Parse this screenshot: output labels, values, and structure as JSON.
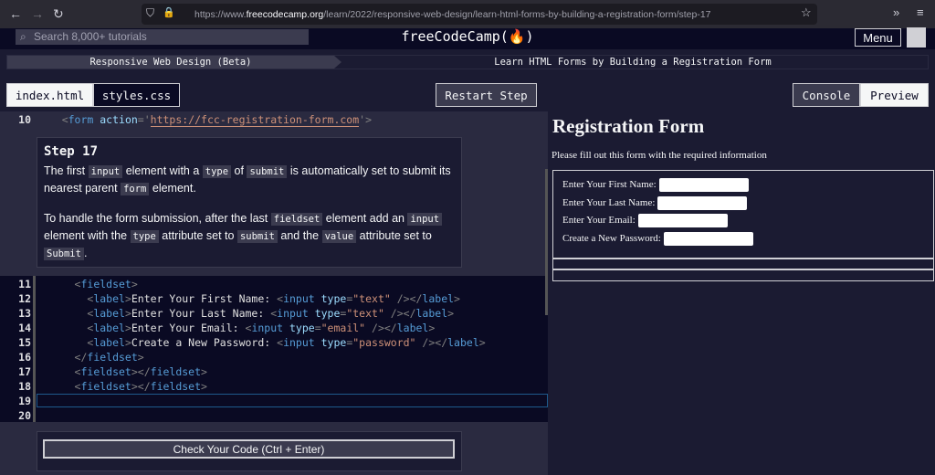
{
  "browser": {
    "url_prefix": "https://www.",
    "url_domain": "freecodecamp.org",
    "url_path": "/learn/2022/responsive-web-design/learn-html-forms-by-building-a-registration-form/step-17"
  },
  "nav": {
    "search_placeholder": "Search 8,000+ tutorials",
    "logo": "freeCodeCamp(🔥)",
    "menu": "Menu"
  },
  "breadcrumb": {
    "superblock": "Responsive Web Design (Beta)",
    "block": "Learn HTML Forms by Building a Registration Form"
  },
  "toolbar": {
    "tabs": [
      "index.html",
      "styles.css"
    ],
    "restart": "Restart Step",
    "console": "Console",
    "preview": "Preview"
  },
  "editor": {
    "line10": {
      "num": "10",
      "tokens": [
        [
          "t",
          "    <"
        ],
        [
          "n",
          "form"
        ],
        [
          "a",
          " action"
        ],
        [
          "t",
          "='"
        ],
        [
          "s",
          "https://fcc-registration-form.com"
        ],
        [
          "t",
          "'>"
        ]
      ]
    },
    "lines": [
      {
        "num": "11",
        "tokens": [
          [
            "t",
            "      <"
          ],
          [
            "n",
            "fieldset"
          ],
          [
            "t",
            ">"
          ]
        ]
      },
      {
        "num": "12",
        "tokens": [
          [
            "t",
            "        <"
          ],
          [
            "n",
            "label"
          ],
          [
            "t",
            ">"
          ],
          [
            "x",
            "Enter Your First Name: "
          ],
          [
            "t",
            "<"
          ],
          [
            "n",
            "input"
          ],
          [
            "a",
            " type"
          ],
          [
            "t",
            "="
          ],
          [
            "s",
            "\"text\""
          ],
          [
            "t",
            " /></"
          ],
          [
            "n",
            "label"
          ],
          [
            "t",
            ">"
          ]
        ]
      },
      {
        "num": "13",
        "tokens": [
          [
            "t",
            "        <"
          ],
          [
            "n",
            "label"
          ],
          [
            "t",
            ">"
          ],
          [
            "x",
            "Enter Your Last Name: "
          ],
          [
            "t",
            "<"
          ],
          [
            "n",
            "input"
          ],
          [
            "a",
            " type"
          ],
          [
            "t",
            "="
          ],
          [
            "s",
            "\"text\""
          ],
          [
            "t",
            " /></"
          ],
          [
            "n",
            "label"
          ],
          [
            "t",
            ">"
          ]
        ]
      },
      {
        "num": "14",
        "tokens": [
          [
            "t",
            "        <"
          ],
          [
            "n",
            "label"
          ],
          [
            "t",
            ">"
          ],
          [
            "x",
            "Enter Your Email: "
          ],
          [
            "t",
            "<"
          ],
          [
            "n",
            "input"
          ],
          [
            "a",
            " type"
          ],
          [
            "t",
            "="
          ],
          [
            "s",
            "\"email\""
          ],
          [
            "t",
            " /></"
          ],
          [
            "n",
            "label"
          ],
          [
            "t",
            ">"
          ]
        ]
      },
      {
        "num": "15",
        "tokens": [
          [
            "t",
            "        <"
          ],
          [
            "n",
            "label"
          ],
          [
            "t",
            ">"
          ],
          [
            "x",
            "Create a New Password: "
          ],
          [
            "t",
            "<"
          ],
          [
            "n",
            "input"
          ],
          [
            "a",
            " type"
          ],
          [
            "t",
            "="
          ],
          [
            "s",
            "\"password\""
          ],
          [
            "t",
            " /></"
          ],
          [
            "n",
            "label"
          ],
          [
            "t",
            ">"
          ]
        ]
      },
      {
        "num": "16",
        "tokens": [
          [
            "t",
            "      </"
          ],
          [
            "n",
            "fieldset"
          ],
          [
            "t",
            ">"
          ]
        ]
      },
      {
        "num": "17",
        "tokens": [
          [
            "t",
            "      <"
          ],
          [
            "n",
            "fieldset"
          ],
          [
            "t",
            "></"
          ],
          [
            "n",
            "fieldset"
          ],
          [
            "t",
            ">"
          ]
        ]
      },
      {
        "num": "18",
        "tokens": [
          [
            "t",
            "      <"
          ],
          [
            "n",
            "fieldset"
          ],
          [
            "t",
            "></"
          ],
          [
            "n",
            "fieldset"
          ],
          [
            "t",
            ">"
          ]
        ]
      },
      {
        "num": "19",
        "tokens": []
      },
      {
        "num": "20",
        "tokens": []
      }
    ]
  },
  "step": {
    "title": "Step 17",
    "p1": [
      [
        "The first ",
        ""
      ],
      [
        "input",
        "c"
      ],
      [
        " element with a ",
        ""
      ],
      [
        "type",
        "c"
      ],
      [
        " of ",
        ""
      ],
      [
        "submit",
        "c"
      ],
      [
        " is automatically set to submit its nearest parent ",
        ""
      ],
      [
        "form",
        "c"
      ],
      [
        " element.",
        ""
      ]
    ],
    "p2": [
      [
        "To handle the form submission, after the last ",
        ""
      ],
      [
        "fieldset",
        "c"
      ],
      [
        " element add an ",
        ""
      ],
      [
        "input",
        "c"
      ],
      [
        " element with the ",
        ""
      ],
      [
        "type",
        "c"
      ],
      [
        " attribute set to ",
        ""
      ],
      [
        "submit",
        "c"
      ],
      [
        " and the ",
        ""
      ],
      [
        "value",
        "c"
      ],
      [
        " attribute set to ",
        ""
      ],
      [
        "Submit",
        "c"
      ],
      [
        ".",
        ""
      ]
    ]
  },
  "check_button": "Check Your Code (Ctrl + Enter)",
  "preview": {
    "title": "Registration Form",
    "subtitle": "Please fill out this form with the required information",
    "labels": [
      "Enter Your First Name:",
      "Enter Your Last Name:",
      "Enter Your Email:",
      "Create a New Password:"
    ]
  }
}
